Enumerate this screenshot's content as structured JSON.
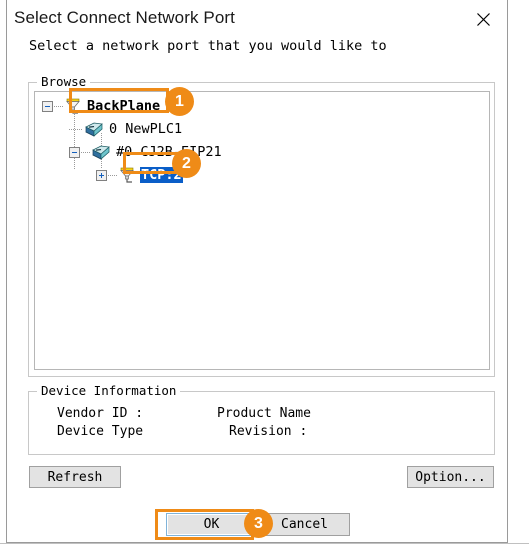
{
  "window": {
    "title": "Select Connect Network Port",
    "close_icon": "close-icon"
  },
  "instruction": "Select a network port that you would like to",
  "browse": {
    "legend": "Browse",
    "tree": [
      {
        "label": "BackPlane",
        "icon": "network-port-icon",
        "expander": "minus",
        "depth": 0,
        "selected": false,
        "bold": true
      },
      {
        "label": "0 NewPLC1",
        "icon": "plc-module-icon",
        "expander": "none",
        "depth": 1,
        "selected": false,
        "bold": false
      },
      {
        "label": "#0 CJ2B-EIP21",
        "icon": "plc-module-icon",
        "expander": "minus",
        "depth": 1,
        "selected": false,
        "bold": false
      },
      {
        "label": "TCP:2",
        "icon": "network-port-icon",
        "expander": "plus",
        "depth": 2,
        "selected": true,
        "bold": true
      }
    ]
  },
  "device_information": {
    "legend": "Device Information",
    "vendor_id_label": "Vendor ID :",
    "product_name_label": "Product Name",
    "device_type_label": "Device Type",
    "revision_label": "Revision :"
  },
  "buttons": {
    "refresh": "Refresh",
    "option": "Option...",
    "ok": "OK",
    "cancel": "Cancel"
  },
  "annotations": {
    "step1": "1",
    "step2": "2",
    "step3": "3",
    "accent_color": "#ef8b17",
    "selection_color": "#0a5ec8"
  }
}
